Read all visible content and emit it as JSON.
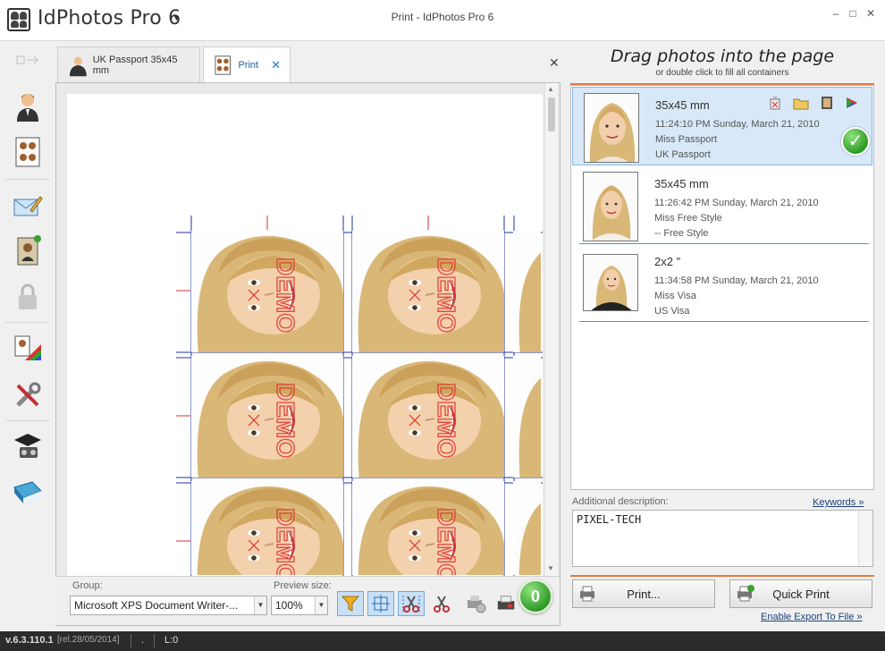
{
  "app": {
    "name": "IdPhotos Pro 6",
    "window_title": "Print - IdPhotos Pro 6"
  },
  "window_buttons": {
    "minimize": "–",
    "maximize": "□",
    "close": "✕"
  },
  "left_toolbar": {
    "icons": [
      "arrows-icon",
      "user-portrait-icon",
      "photo-sheet-icon",
      "email-edit-icon",
      "id-card-icon",
      "lock-icon",
      "color-palette-icon",
      "tools-icon",
      "graduation-video-icon",
      "help-book-icon"
    ]
  },
  "tabs": [
    {
      "label": "UK Passport 35x45 mm",
      "active": false
    },
    {
      "label": "Print",
      "active": true
    }
  ],
  "tabs_close_all": "✕",
  "preview": {
    "watermark": "DEMO",
    "group_label": "Group:",
    "group_value": "Microsoft XPS Document Writer-...",
    "preview_size_label": "Preview size:",
    "preview_size_value": "100%",
    "photos_count": "0"
  },
  "right_panel": {
    "drag_title": "Drag photos into the page",
    "drag_subtitle": "or double click to fill all containers",
    "items": [
      {
        "size": "35x45 mm",
        "time": "11:24:10 PM   Sunday, March 21, 2010",
        "line3": "Miss Passport",
        "line4": "UK Passport",
        "selected": true
      },
      {
        "size": "35x45 mm",
        "time": "11:26:42 PM   Sunday, March 21, 2010",
        "line3": "Miss Free Style",
        "line4": "-- Free Style",
        "selected": false
      },
      {
        "size": "2x2 \"",
        "time": "11:34:58 PM   Sunday, March 21, 2010",
        "line3": "Miss Visa",
        "line4": "US Visa",
        "selected": false
      }
    ],
    "additional_description_label": "Additional description:",
    "keywords_link": "Keywords »",
    "description_value": "PIXEL-TECH",
    "print_button": "Print...",
    "quick_print_button": "Quick Print",
    "export_link": "Enable Export To File »"
  },
  "status_bar": {
    "version": "v.6.3.110.1",
    "release": "[rel.28/05/2014]",
    "item2": ".",
    "item3": "L:0"
  },
  "colors": {
    "accent_orange": "#e47a3c",
    "selection_blue": "#d8e8f8",
    "link_blue": "#1e3f7a",
    "badge_green": "#2f9a27",
    "guide_red": "#d03030",
    "guide_blue": "#2030a0"
  }
}
